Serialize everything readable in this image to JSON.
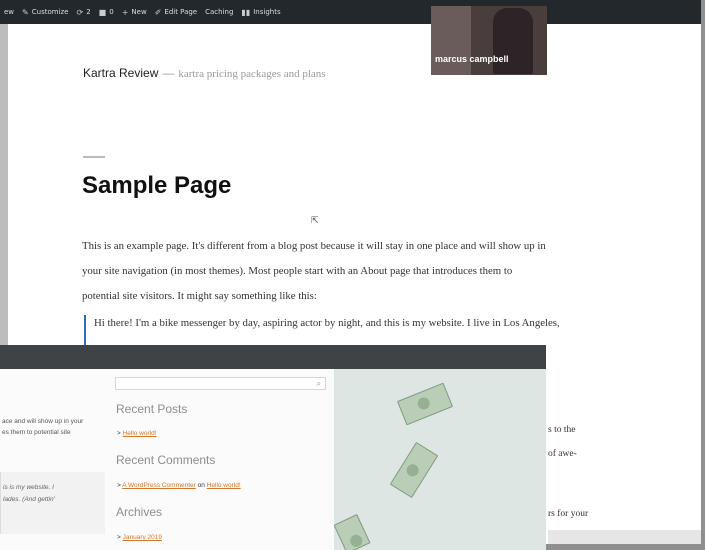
{
  "adminbar": {
    "items": [
      {
        "icon": "view-icon",
        "label": "ew"
      },
      {
        "icon": "brush-icon",
        "label": "Customize"
      },
      {
        "icon": "refresh-icon",
        "label": "2"
      },
      {
        "icon": "comment-icon",
        "label": "0"
      },
      {
        "icon": "plus-icon",
        "label": "New"
      },
      {
        "icon": "pencil-icon",
        "label": "Edit Page"
      },
      {
        "icon": "",
        "label": "Caching"
      },
      {
        "icon": "bar-chart-icon",
        "label": "Insights"
      }
    ]
  },
  "site": {
    "title": "Kartra Review",
    "separator": "—",
    "description": "kartra pricing packages and plans"
  },
  "page": {
    "title": "Sample Page",
    "body_lines": [
      "This is an example page. It's different from a blog post because it will stay in one place and will show up in",
      "your site navigation (in most themes). Most people start with an About page that introduces them to",
      "potential site visitors. It might say something like this:"
    ],
    "quote": "Hi there! I'm a bike messenger by day, aspiring actor by night, and this is my website. I live in Los Angeles,",
    "fragments": [
      "s to the",
      "of awe-",
      "rs for your"
    ]
  },
  "front": {
    "left_lines": [
      "ace and will show up in your",
      "es them to potential site"
    ],
    "quote_lines": [
      "is is my website. I",
      "lades. (And gettin'"
    ],
    "sidebar": {
      "recent_posts_title": "Recent Posts",
      "recent_posts": [
        "Hello world!"
      ],
      "recent_comments_title": "Recent Comments",
      "comment_author": "A WordPress Commenter",
      "comment_on": "on",
      "comment_post": "Hello world!",
      "archives_title": "Archives",
      "archives": [
        "January 2019"
      ],
      "bullet": ">"
    },
    "webcam_name": "marcus campbell"
  },
  "colors": {
    "adminbar": "#23282d",
    "link": "#d0772e",
    "quote_border": "#2a6db0"
  }
}
